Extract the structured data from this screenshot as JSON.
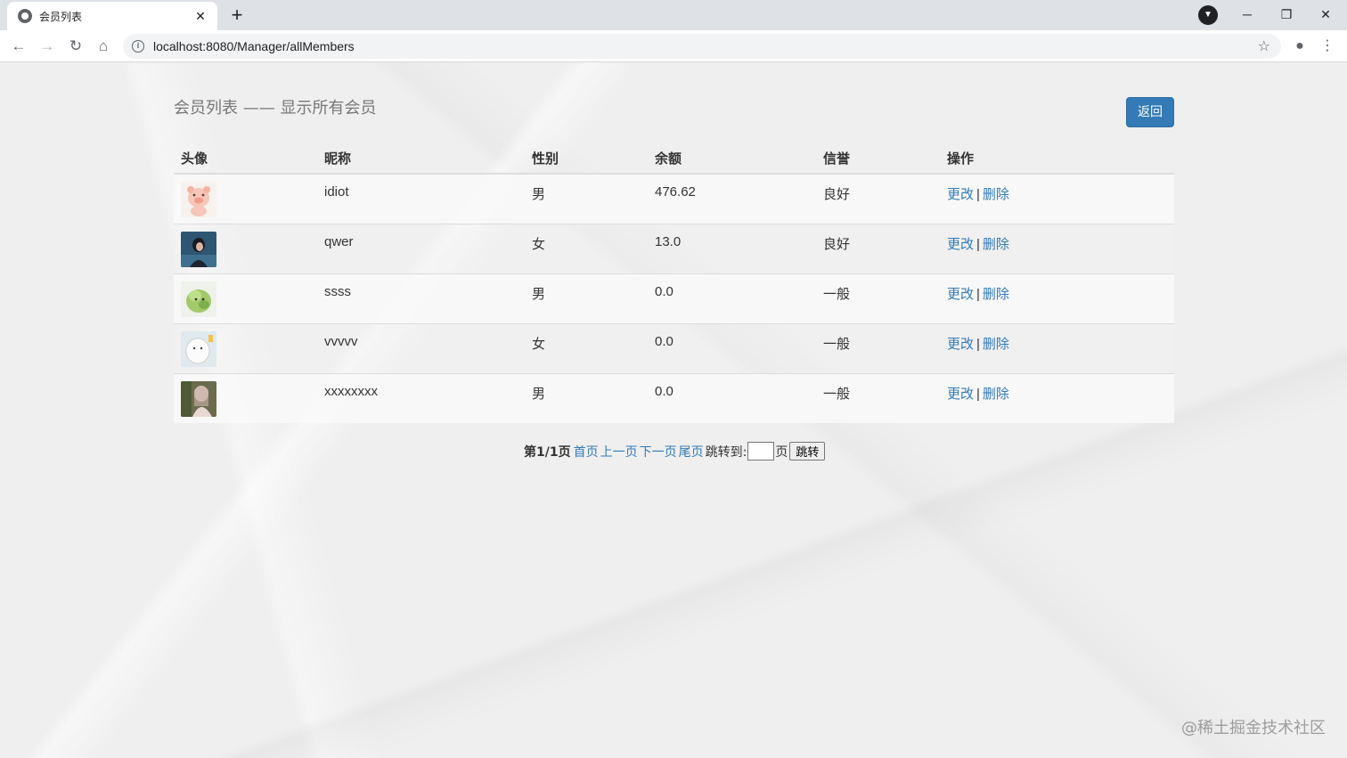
{
  "browser": {
    "tab_title": "会员列表",
    "tab_close": "✕",
    "new_tab": "+",
    "url": "localhost:8080/Manager/allMembers",
    "window_controls": [
      "─",
      "❐",
      "✕"
    ],
    "icons": [
      "favicon-icon",
      "back-arrow-icon",
      "forward-arrow-icon",
      "reload-icon",
      "home-icon",
      "info-icon",
      "star-icon",
      "profile-icon",
      "menu-icon"
    ]
  },
  "page": {
    "heading": "会员列表 —— 显示所有会员",
    "back_button": "返回",
    "table": {
      "headers": [
        "头像",
        "昵称",
        "性别",
        "余额",
        "信誉",
        "操作"
      ],
      "rows": [
        {
          "nickname": "idiot",
          "gender": "男",
          "balance": "476.62",
          "credit": "良好",
          "edit": "更改",
          "delete": "删除",
          "avatar": "cartoon-pig-avatar"
        },
        {
          "nickname": "qwer",
          "gender": "女",
          "balance": "13.0",
          "credit": "良好",
          "edit": "更改",
          "delete": "删除",
          "avatar": "person-photo-avatar"
        },
        {
          "nickname": "ssss",
          "gender": "男",
          "balance": "0.0",
          "credit": "一般",
          "edit": "更改",
          "delete": "删除",
          "avatar": "green-creature-avatar"
        },
        {
          "nickname": "vvvvv",
          "gender": "女",
          "balance": "0.0",
          "credit": "一般",
          "edit": "更改",
          "delete": "删除",
          "avatar": "white-cartoon-avatar"
        },
        {
          "nickname": "xxxxxxxx",
          "gender": "男",
          "balance": "0.0",
          "credit": "一般",
          "edit": "更改",
          "delete": "删除",
          "avatar": "girl-photo-avatar"
        }
      ],
      "separator": "|"
    },
    "pager": {
      "status": "第1/1页",
      "first": "首页",
      "prev": "上一页",
      "next": "下一页",
      "last": "尾页",
      "jump_label": "跳转到:",
      "page_suffix": "页",
      "jump_button": "跳转",
      "input_value": ""
    },
    "watermark": "@稀土掘金技术社区"
  },
  "colors": {
    "link": "#337ab7",
    "button": "#337ab7",
    "heading": "#777777"
  }
}
